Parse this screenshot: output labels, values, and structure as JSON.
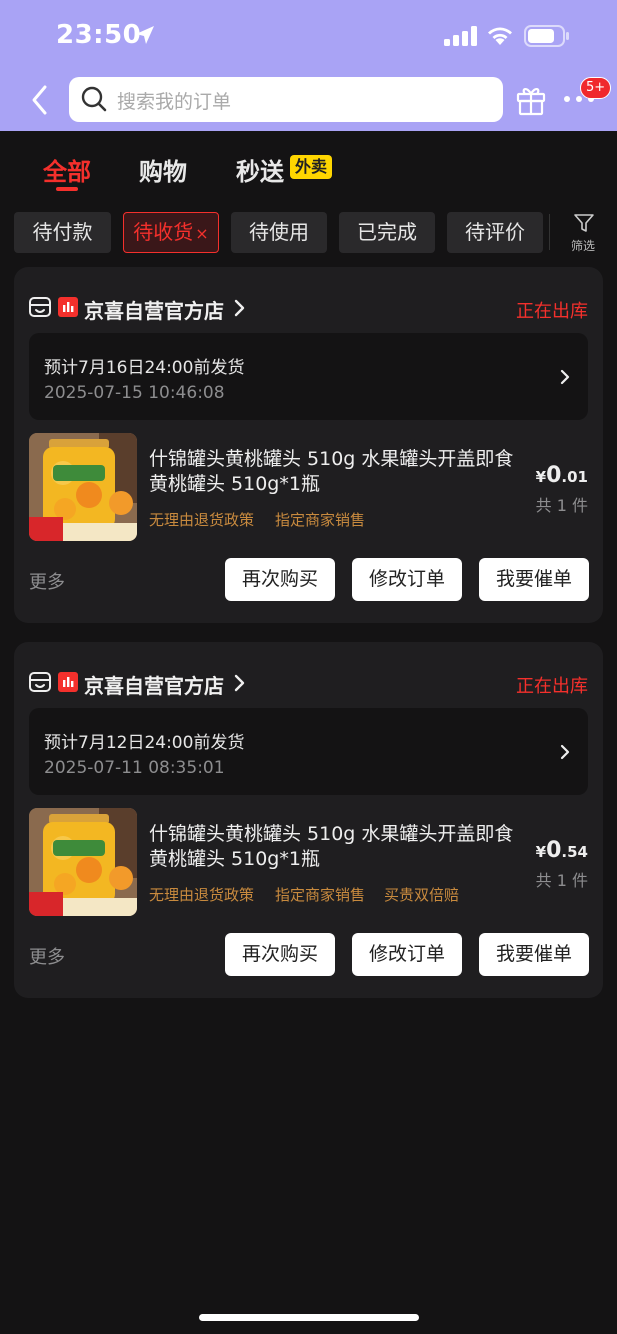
{
  "status_bar": {
    "time": "23:50"
  },
  "search": {
    "placeholder": "搜索我的订单"
  },
  "header": {
    "badge": "5+"
  },
  "tabs": [
    {
      "label": "全部"
    },
    {
      "label": "购物"
    },
    {
      "label": "秒送"
    }
  ],
  "tab_badge": "外卖",
  "filters": [
    {
      "label": "待付款"
    },
    {
      "label": "待收货"
    },
    {
      "label": "待使用"
    },
    {
      "label": "已完成"
    },
    {
      "label": "待评价"
    }
  ],
  "filter_close": "×",
  "filter_button": "筛选",
  "orders": [
    {
      "store": "京喜自营官方店",
      "status": "正在出库",
      "ship_title": "预计7月16日24:00前发货",
      "ship_time": "2025-07-15 10:46:08",
      "product_title": "什锦罐头黄桃罐头 510g 水果罐头开盖即食 黄桃罐头 510g*1瓶",
      "tags": [
        "无理由退货政策",
        "指定商家销售"
      ],
      "price_symbol": "¥",
      "price_int": "0",
      "price_dec": ".01",
      "qty": "共 1 件",
      "more": "更多",
      "buttons": [
        "再次购买",
        "修改订单",
        "我要催单"
      ]
    },
    {
      "store": "京喜自营官方店",
      "status": "正在出库",
      "ship_title": "预计7月12日24:00前发货",
      "ship_time": "2025-07-11 08:35:01",
      "product_title": "什锦罐头黄桃罐头 510g 水果罐头开盖即食 黄桃罐头 510g*1瓶",
      "tags": [
        "无理由退货政策",
        "指定商家销售",
        "买贵双倍赔"
      ],
      "price_symbol": "¥",
      "price_int": "0",
      "price_dec": ".54",
      "qty": "共 1 件",
      "more": "更多",
      "buttons": [
        "再次购买",
        "修改订单",
        "我要催单"
      ]
    }
  ],
  "colors": {
    "header_bg": "#a9a3f5",
    "page_bg": "#141314",
    "card_bg": "#1f1e20",
    "accent_red": "#f4302c",
    "tag_gold": "#c88a3e",
    "waimai_yellow": "#ffd600"
  }
}
